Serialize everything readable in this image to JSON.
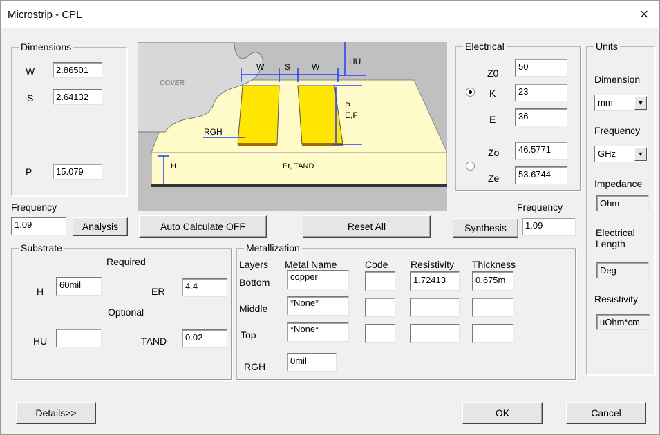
{
  "window": {
    "title": "Microstrip - CPL",
    "close": "×"
  },
  "dimensions": {
    "title": "Dimensions",
    "w_label": "W",
    "w_value": "2.86501",
    "s_label": "S",
    "s_value": "2.64132",
    "p_label": "P",
    "p_value": "15.079"
  },
  "diagram": {
    "cover": "COVER",
    "w1": "W",
    "s": "S",
    "w2": "W",
    "hu": "HU",
    "p": "P",
    "ef": "E,F",
    "rgh": "RGH",
    "h": "H",
    "er_tand": "Er, TAND"
  },
  "electrical": {
    "title": "Electrical",
    "z0_label": "Z0",
    "z0_value": "50",
    "k_label": "K",
    "k_value": "23",
    "e_label": "E",
    "e_value": "36",
    "zo_label": "Zo",
    "zo_value": "46.5771",
    "ze_label": "Ze",
    "ze_value": "53.6744",
    "mode": "K/E"
  },
  "units": {
    "title": "Units",
    "dimension_label": "Dimension",
    "dimension_value": "mm",
    "frequency_label": "Frequency",
    "frequency_value": "GHz",
    "impedance_label": "Impedance",
    "impedance_value": "Ohm",
    "electrical_length_label": "Electrical Length",
    "electrical_length_value": "Deg",
    "resistivity_label": "Resistivity",
    "resistivity_value": "uOhm*cm"
  },
  "analysis": {
    "frequency_label": "Frequency",
    "frequency_value": "1.09",
    "button": "Analysis"
  },
  "synthesis": {
    "frequency_label": "Frequency",
    "frequency_value": "1.09",
    "button": "Synthesis"
  },
  "auto_calc_button": "Auto Calculate OFF",
  "reset_button": "Reset  All",
  "substrate": {
    "title": "Substrate",
    "required": "Required",
    "optional": "Optional",
    "h_label": "H",
    "h_value": "60mil",
    "er_label": "ER",
    "er_value": "4.4",
    "hu_label": "HU",
    "hu_value": "",
    "tand_label": "TAND",
    "tand_value": "0.02"
  },
  "metallization": {
    "title": "Metallization",
    "headers": {
      "layers": "Layers",
      "metal": "Metal Name",
      "code": "Code",
      "resistivity": "Resistivity",
      "thickness": "Thickness"
    },
    "rows": [
      {
        "layer": "Bottom",
        "metal": "copper",
        "code": "",
        "resistivity": "1.72413",
        "thickness": "0.675m"
      },
      {
        "layer": "Middle",
        "metal": "*None*",
        "code": "",
        "resistivity": "",
        "thickness": ""
      },
      {
        "layer": "Top",
        "metal": "*None*",
        "code": "",
        "resistivity": "",
        "thickness": ""
      }
    ],
    "rgh_label": "RGH",
    "rgh_value": "0mil"
  },
  "footer": {
    "details": "Details>>",
    "ok": "OK",
    "cancel": "Cancel"
  },
  "colors": {
    "conductor": "#ffe600",
    "substrate": "#fffbc8",
    "dialog_bg": "#f0f0f0",
    "diagram_bg": "#c0c0c0",
    "line_blue": "#1e3cff"
  }
}
